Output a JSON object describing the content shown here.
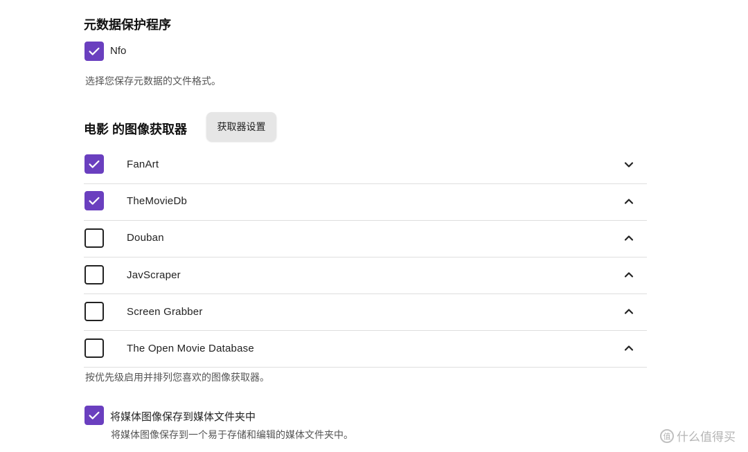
{
  "metadata_savers": {
    "title": "元数据保护程序",
    "nfo": {
      "label": "Nfo",
      "checked": true
    },
    "helper": "选择您保存元数据的文件格式。"
  },
  "image_fetchers": {
    "title": "电影 的图像获取器",
    "settings_button": "获取器设置",
    "items": [
      {
        "label": "FanArt",
        "checked": true,
        "chevron": "down"
      },
      {
        "label": "TheMovieDb",
        "checked": true,
        "chevron": "up"
      },
      {
        "label": "Douban",
        "checked": false,
        "chevron": "up"
      },
      {
        "label": "JavScraper",
        "checked": false,
        "chevron": "up"
      },
      {
        "label": "Screen Grabber",
        "checked": false,
        "chevron": "up"
      },
      {
        "label": "The Open Movie Database",
        "checked": false,
        "chevron": "up"
      }
    ],
    "helper": "按优先级启用并排列您喜欢的图像获取器。"
  },
  "save_to_media_folder": {
    "label": "将媒体图像保存到媒体文件夹中",
    "checked": true,
    "description": "将媒体图像保存到一个易于存储和编辑的媒体文件夹中。"
  },
  "watermark": {
    "symbol": "值",
    "text": "什么值得买"
  },
  "colors": {
    "accent": "#6a3fbf",
    "separator": "#dedede"
  }
}
